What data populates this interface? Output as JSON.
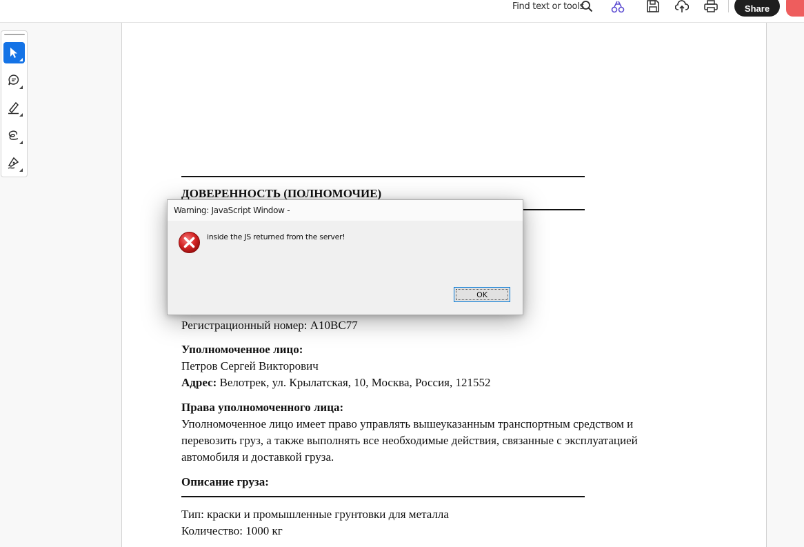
{
  "toolbar": {
    "find_label": "Find text or tools",
    "share_label": "Share",
    "icons": [
      "search-icon",
      "edit-tools-icon",
      "save-icon",
      "upload-icon",
      "print-icon",
      "comment-icon"
    ]
  },
  "tool_rail": {
    "tools": [
      "select-tool",
      "comment-tool",
      "highlight-tool",
      "draw-tool",
      "sign-tool"
    ],
    "active": "select-tool",
    "accent": "#1473e6"
  },
  "document": {
    "title": "ДОВЕРЕННОСТЬ (ПОЛНОМОЧИЕ)",
    "reg_number": "Регистрационный номер: А10ВС77",
    "authorized_heading": "Уполномоченное лицо:",
    "authorized_name": "Петров Сергей Викторович",
    "address_label": "Адрес:",
    "address_value": " Велотрек, ул. Крылатская, 10, Москва, Россия, 121552",
    "rights_heading": "Права уполномоченного лица:",
    "rights_lines": [
      "Уполномоченное лицо имеет право управлять вышеуказанным транспортным средством и",
      "перевозить груз, а также выполнять все необходимые действия, связанные с эксплуатацией",
      "автомобиля и доставкой груза."
    ],
    "cargo_heading": "Описание груза:",
    "cargo_type": "Тип: краски и промышленные грунтовки для металла",
    "cargo_qty": "Количество: 1000 кг"
  },
  "dialog": {
    "title": "Warning: JavaScript Window -",
    "message": "inside the JS returned from the server!",
    "ok_label": "OK",
    "icon": "error-icon"
  }
}
